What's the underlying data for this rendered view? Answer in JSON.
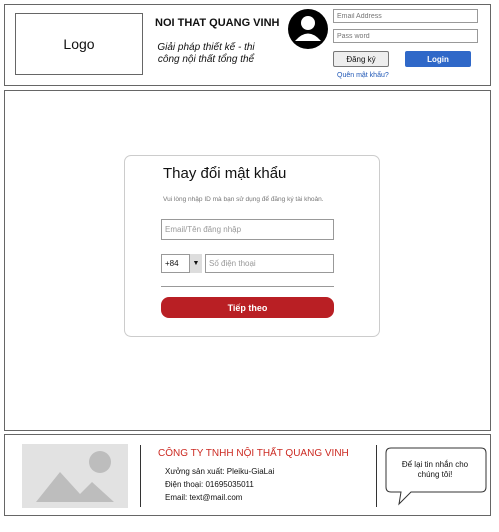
{
  "header": {
    "logo_label": "Logo",
    "brand_title": "NOI THAT QUANG VINH",
    "slogan": "Giải pháp thiết kế - thi công nội thất tổng thể",
    "email_placeholder": "Email Address",
    "password_placeholder": "Pass word",
    "register_label": "Đăng ký",
    "login_label": "Login",
    "forgot_label": "Quên mật khẩu?",
    "login_color": "#2f68c8"
  },
  "form": {
    "title": "Thay đổi mật khẩu",
    "hint": "Vui lòng nhập ID mà bạn sử dụng để đăng ký  tài khoản.",
    "username_placeholder": "Email/Tên đăng nhập",
    "country_code": "+84",
    "phone_placeholder": "Số điện thoại",
    "next_label": "Tiếp theo",
    "accent_color": "#b91f24"
  },
  "footer": {
    "company": "CÔNG TY TNHH NỘI THẤT QUANG VINH",
    "workshop": "Xưởng sản xuất: Pleiku-GiaLai",
    "phone": "Điện thoại: 01695035011",
    "email": "Email: text@mail.com",
    "chat_text": "Để lại tin nhắn cho chúng tôi!",
    "company_color": "#cc2a22"
  },
  "icons": {
    "avatar": "user-avatar-icon",
    "image": "image-placeholder-icon",
    "dropdown": "chevron-down-icon",
    "chat": "speech-bubble-icon"
  }
}
